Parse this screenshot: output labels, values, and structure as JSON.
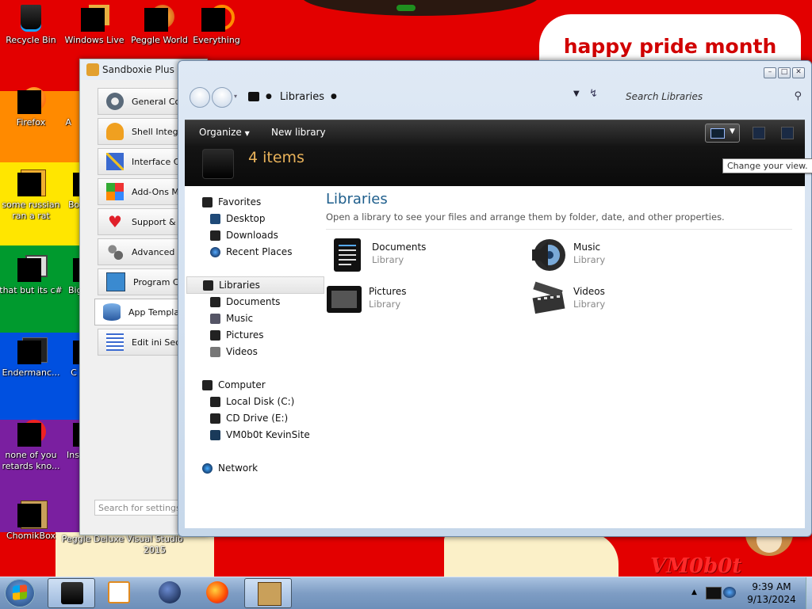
{
  "desktop": {
    "icons": [
      {
        "label": "Recycle Bin"
      },
      {
        "label": "Windows Live"
      },
      {
        "label": "Peggle World"
      },
      {
        "label": "Everything"
      },
      {
        "label": "Firefox"
      },
      {
        "label": "A"
      },
      {
        "label": "some russian ran a rat"
      },
      {
        "label": "Bo"
      },
      {
        "label": "that but its c#"
      },
      {
        "label": "Big"
      },
      {
        "label": "Endermanc..."
      },
      {
        "label": "C"
      },
      {
        "label": "none of you retards kno..."
      },
      {
        "label": "Ins"
      },
      {
        "label": "ChomikBox"
      },
      {
        "label": "Peggle Deluxe"
      },
      {
        "label": "Visual Studio 2015"
      }
    ],
    "pride_text": "happy pride month",
    "watermark": "VM0b0t"
  },
  "sandboxie": {
    "title": "Sandboxie Plus - G",
    "nav": [
      {
        "label": "General Co"
      },
      {
        "label": "Shell Integra"
      },
      {
        "label": "Interface Co"
      },
      {
        "label": "Add-Ons Mar"
      },
      {
        "label": "Support & Up"
      },
      {
        "label": "Advanced C"
      },
      {
        "label": "Program Co"
      },
      {
        "label": "App Templa"
      },
      {
        "label": "Edit ini Sec"
      }
    ],
    "search_placeholder": "Search for settings"
  },
  "explorer": {
    "breadcrumb": "Libraries",
    "search_placeholder": "Search Libraries",
    "toolbar": {
      "organize": "Organize",
      "new_library": "New library"
    },
    "items_count": "4 items",
    "tooltip": "Change your view.",
    "nav": {
      "favorites": "Favorites",
      "desktop": "Desktop",
      "downloads": "Downloads",
      "recent": "Recent Places",
      "libraries": "Libraries",
      "documents": "Documents",
      "music": "Music",
      "pictures": "Pictures",
      "videos": "Videos",
      "computer": "Computer",
      "local_disk": "Local Disk (C:)",
      "cd_drive": "CD Drive (E:)",
      "vm_site": "VM0b0t KevinSite",
      "network": "Network"
    },
    "main": {
      "heading": "Libraries",
      "description": "Open a library to see your files and arrange them by folder, date, and other properties.",
      "libraries": [
        {
          "name": "Documents",
          "type": "Library"
        },
        {
          "name": "Music",
          "type": "Library"
        },
        {
          "name": "Pictures",
          "type": "Library"
        },
        {
          "name": "Videos",
          "type": "Library"
        }
      ]
    }
  },
  "taskbar": {
    "time": "9:39 AM",
    "date": "9/13/2024"
  }
}
